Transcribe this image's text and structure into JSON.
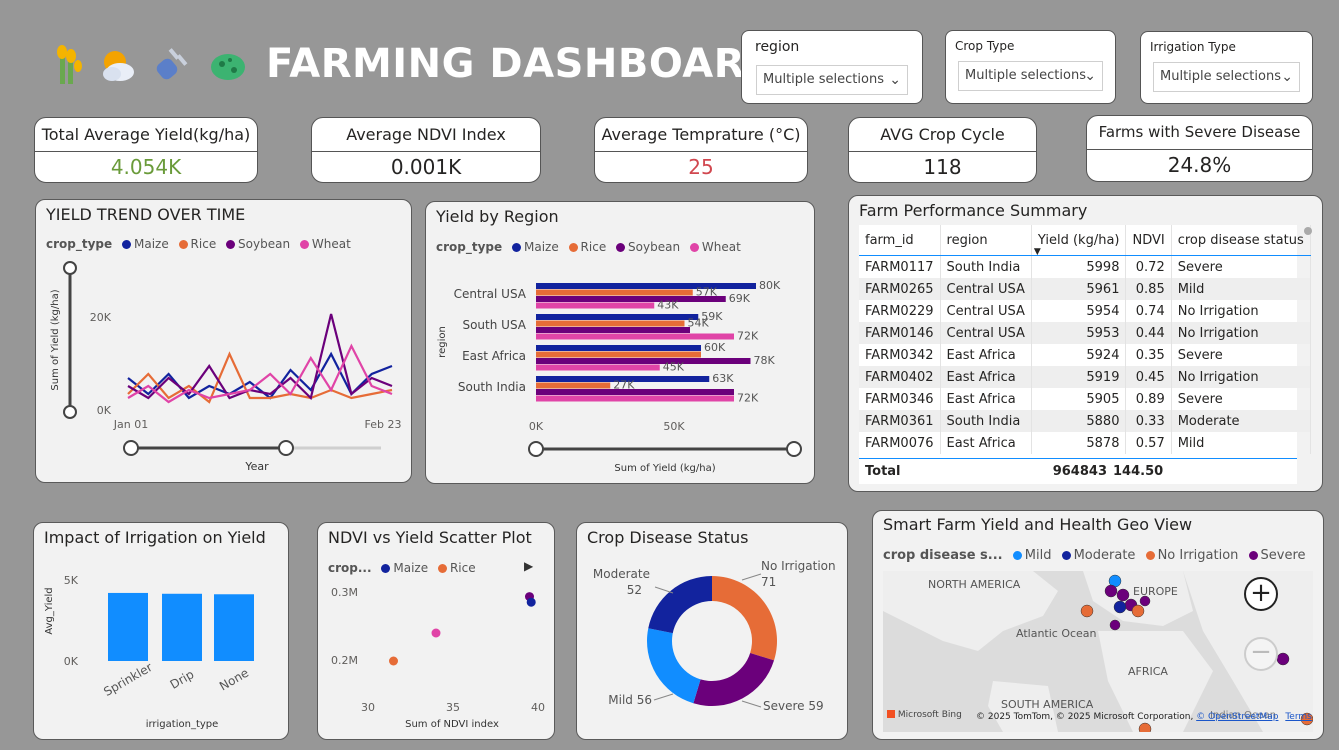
{
  "header": {
    "title": "FARMING DASHBOARD",
    "icons": [
      "crop-icon",
      "weather-icon",
      "sensor-plug-icon",
      "disease-germ-icon"
    ]
  },
  "slicers": [
    {
      "label": "region",
      "value": "Multiple selections"
    },
    {
      "label": "Crop Type",
      "value": "Multiple selections"
    },
    {
      "label": "Irrigation Type",
      "value": "Multiple selections"
    }
  ],
  "kpis": [
    {
      "label": "Total Average Yield(kg/ha)",
      "value": "4.054K",
      "color": "#6a9b3a"
    },
    {
      "label": "Average NDVI Index",
      "value": "0.001K",
      "color": "#252423"
    },
    {
      "label": "Average Temprature (°C)",
      "value": "25",
      "color": "#d1474f"
    },
    {
      "label": "AVG Crop Cycle",
      "value": "118",
      "color": "#252423"
    },
    {
      "label": "Farms with Severe Disease",
      "value": "24.8%",
      "color": "#252423"
    }
  ],
  "colors": {
    "maize": "#12239e",
    "rice": "#e66c37",
    "soybean": "#6b007b",
    "wheat": "#e044a7",
    "bar_blue": "#118dff",
    "mild": "#118dff",
    "moderate": "#12239e",
    "no_irrigation": "#e66c37",
    "severe": "#6b007b"
  },
  "yield_trend": {
    "title": "YIELD TREND OVER TIME",
    "legend_title": "crop_type",
    "legend": [
      "Maize",
      "Rice",
      "Soybean",
      "Wheat"
    ],
    "ylabel": "Sum of Yield (kg/ha)",
    "xlabel": "Year",
    "yticks": [
      "20K",
      "0K"
    ],
    "xticks": [
      "Jan 01",
      "Feb 23"
    ]
  },
  "yield_region": {
    "title": "Yield by Region",
    "legend_title": "crop_type",
    "legend": [
      "Maize",
      "Rice",
      "Soybean",
      "Wheat"
    ],
    "ylabel": "region",
    "xlabel": "Sum of Yield (kg/ha)",
    "xticks": [
      "0K",
      "50K"
    ]
  },
  "farm_table": {
    "title": "Farm Performance Summary",
    "columns": [
      "farm_id",
      "region",
      "Yield (kg/ha)",
      "NDVI",
      "crop disease status"
    ],
    "rows": [
      [
        "FARM0117",
        "South India",
        "5998",
        "0.72",
        "Severe"
      ],
      [
        "FARM0265",
        "Central USA",
        "5961",
        "0.85",
        "Mild"
      ],
      [
        "FARM0229",
        "Central USA",
        "5954",
        "0.74",
        "No Irrigation"
      ],
      [
        "FARM0146",
        "Central USA",
        "5953",
        "0.44",
        "No Irrigation"
      ],
      [
        "FARM0342",
        "East Africa",
        "5924",
        "0.35",
        "Severe"
      ],
      [
        "FARM0402",
        "East Africa",
        "5919",
        "0.45",
        "No Irrigation"
      ],
      [
        "FARM0346",
        "East Africa",
        "5905",
        "0.89",
        "Severe"
      ],
      [
        "FARM0361",
        "South India",
        "5880",
        "0.33",
        "Moderate"
      ],
      [
        "FARM0076",
        "East Africa",
        "5878",
        "0.57",
        "Mild"
      ]
    ],
    "total": {
      "label": "Total",
      "yield": "964843",
      "ndvi": "144.50"
    }
  },
  "irrigation": {
    "title": "Impact of Irrigation on Yield",
    "ylabel": "Avg_Yield",
    "xlabel": "irrigation_type",
    "yticks": [
      "5K",
      "0K"
    ]
  },
  "scatter": {
    "title": "NDVI vs Yield Scatter Plot",
    "legend_title": "crop...",
    "legend": [
      "Maize",
      "Rice"
    ],
    "xlabel": "Sum of NDVI index",
    "yticks": [
      "0.3M",
      "0.2M"
    ],
    "xticks": [
      "30",
      "35",
      "40"
    ]
  },
  "disease": {
    "title": "Crop Disease Status"
  },
  "geo": {
    "title": "Smart Farm Yield and Health Geo View",
    "legend_title": "crop disease s...",
    "legend": [
      "Mild",
      "Moderate",
      "No Irrigation",
      "Severe"
    ],
    "labels": {
      "north_america": "NORTH AMERICA",
      "europe": "EUROPE",
      "atlantic": "Atlantic Ocean",
      "africa": "AFRICA",
      "south_america": "SOUTH AMERICA",
      "indian": "Indian Ocean"
    },
    "brand": "Microsoft Bing",
    "attribution": "© 2025 TomTom, © 2025 Microsoft Corporation,",
    "osm": "© OpenStreetMap",
    "terms": "Terms"
  },
  "chart_data": [
    {
      "type": "line",
      "title": "YIELD TREND OVER TIME",
      "xlabel": "Year",
      "ylabel": "Sum of Yield (kg/ha)",
      "x": [
        "Jan 01",
        "Jan 05",
        "Jan 09",
        "Jan 13",
        "Jan 17",
        "Jan 21",
        "Jan 25",
        "Jan 29",
        "Feb 02",
        "Feb 06",
        "Feb 10",
        "Feb 14",
        "Feb 18",
        "Feb 23"
      ],
      "ylim": [
        0,
        30000
      ],
      "series": [
        {
          "name": "Maize",
          "values": [
            8000,
            4000,
            9000,
            3000,
            6000,
            4000,
            7000,
            3000,
            10000,
            5000,
            14000,
            4000,
            9000,
            11000
          ]
        },
        {
          "name": "Rice",
          "values": [
            4000,
            9000,
            3000,
            6000,
            2000,
            14000,
            3000,
            3000,
            4000,
            3000,
            5000,
            3000,
            4000,
            5000
          ]
        },
        {
          "name": "Soybean",
          "values": [
            6000,
            3000,
            8000,
            4000,
            11000,
            3000,
            5000,
            4000,
            8000,
            3000,
            24000,
            4000,
            8000,
            6000
          ]
        },
        {
          "name": "Wheat",
          "values": [
            3000,
            6000,
            2000,
            5000,
            3000,
            4000,
            5000,
            9000,
            4000,
            13000,
            5000,
            16000,
            6000,
            4000
          ]
        }
      ]
    },
    {
      "type": "bar",
      "orientation": "horizontal",
      "title": "Yield by Region",
      "categories": [
        "Central USA",
        "South USA",
        "East Africa",
        "South India"
      ],
      "xlim": [
        0,
        80000
      ],
      "series": [
        {
          "name": "Maize",
          "values": [
            80000,
            59000,
            60000,
            63000
          ]
        },
        {
          "name": "Rice",
          "values": [
            57000,
            54000,
            60000,
            27000
          ]
        },
        {
          "name": "Soybean",
          "values": [
            69000,
            56000,
            78000,
            72000
          ]
        },
        {
          "name": "Wheat",
          "values": [
            43000,
            72000,
            45000,
            72000
          ]
        }
      ],
      "labels": [
        [
          "80K",
          "57K",
          "69K",
          "43K"
        ],
        [
          "59K",
          "54K",
          "",
          "72K"
        ],
        [
          "60K",
          "",
          "78K",
          "45K"
        ],
        [
          "63K",
          "27K",
          "",
          "72K"
        ]
      ]
    },
    {
      "type": "bar",
      "title": "Impact of Irrigation on Yield",
      "categories": [
        "Sprinkler",
        "Drip",
        "None"
      ],
      "values": [
        4100,
        4050,
        4020
      ],
      "ylim": [
        0,
        5000
      ]
    },
    {
      "type": "scatter",
      "title": "NDVI vs Yield Scatter Plot",
      "xlim": [
        30,
        40
      ],
      "ylim": [
        180000,
        330000
      ],
      "points": [
        {
          "series": "Rice",
          "x": 31.5,
          "y": 200000
        },
        {
          "series": "Wheat",
          "x": 34,
          "y": 240000
        },
        {
          "series": "Soybean",
          "x": 39.5,
          "y": 292000
        },
        {
          "series": "Maize",
          "x": 39.6,
          "y": 284000
        }
      ]
    },
    {
      "type": "pie",
      "donut": true,
      "title": "Crop Disease Status",
      "slices": [
        {
          "name": "No Irrigation",
          "value": 71
        },
        {
          "name": "Severe",
          "value": 59
        },
        {
          "name": "Mild",
          "value": 56
        },
        {
          "name": "Moderate",
          "value": 52
        }
      ]
    }
  ]
}
